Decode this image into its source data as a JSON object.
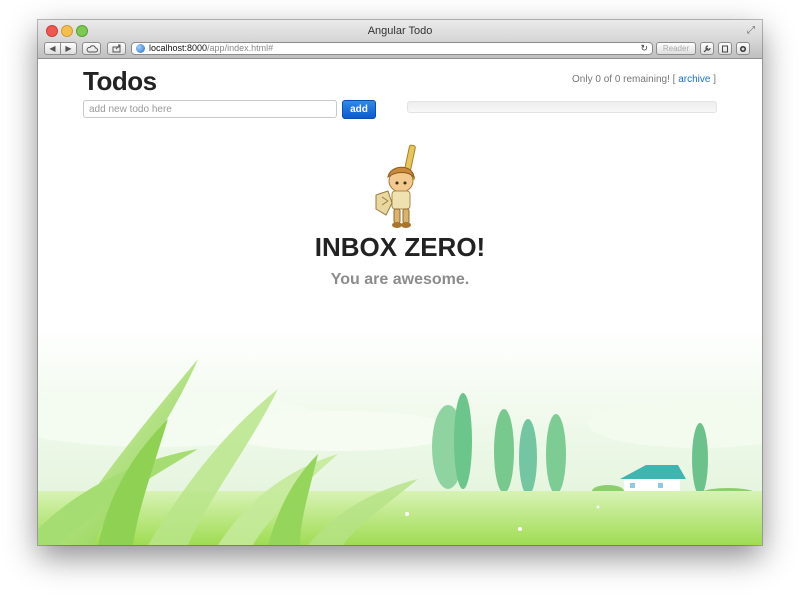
{
  "window": {
    "title": "Angular Todo"
  },
  "browser": {
    "url_host": "localhost:8000",
    "url_path": "/app/index.html#",
    "reader_label": "Reader"
  },
  "app": {
    "title": "Todos",
    "remaining_text": "Only 0 of 0 remaining! [",
    "archive_label": "archive",
    "remaining_close": "]",
    "input_placeholder": "add new todo here",
    "input_value": "",
    "add_label": "add",
    "progress_fraction": 0,
    "empty_heading": "INBOX ZERO!",
    "empty_subheading": "You are awesome."
  }
}
